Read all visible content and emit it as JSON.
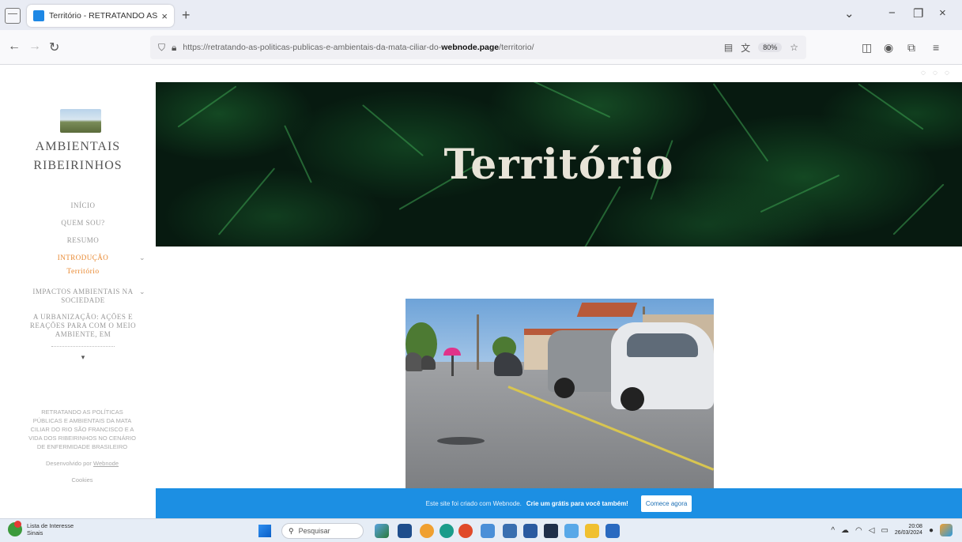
{
  "browser": {
    "tab_title": "Território - RETRATANDO AS P",
    "tab_close": "×",
    "new_tab": "+",
    "url_prefix": "https://retratando-as-politicas-publicas-e-ambientais-da-mata-ciliar-do-",
    "url_domain": "webnode.page",
    "url_suffix": "/territorio/",
    "zoom": "80%",
    "back": "←",
    "forward": "→",
    "reload": "↻",
    "minimize": "−",
    "restore": "❐",
    "close": "×",
    "tabs_dropdown": "⌄"
  },
  "sidebar": {
    "site_name_line1": "AMBIENTAIS",
    "site_name_line2": "RIBEIRINHOS",
    "menu": [
      {
        "label": "INÍCIO"
      },
      {
        "label": "QUEM SOU?"
      },
      {
        "label": "RESUMO"
      },
      {
        "label": "INTRODUÇÃO"
      },
      {
        "label": "Território"
      },
      {
        "label": "IMPACTOS AMBIENTAIS NA SOCIEDADE"
      },
      {
        "label": "A URBANIZAÇÃO: AÇÕES E REAÇÕES PARA COM O MEIO AMBIENTE, EM"
      }
    ],
    "more_arrow": "▾",
    "footer_text": "RETRATANDO AS POLÍTICAS PÚBLICAS E AMBIENTAIS DA MATA CILIAR DO RIO SÃO FRANCISCO E A VIDA DOS RIBEIRINHOS NO CENÁRIO DE ENFERMIDADE BRASILEIRO",
    "powered_by": "Desenvolvido por",
    "powered_link": "Webnode",
    "cookies": "Cookies"
  },
  "hero": {
    "title": "Território"
  },
  "promo": {
    "text": "Este site foi criado com Webnode.",
    "strong": "Crie um grátis para você também!",
    "button": "Comece agora"
  },
  "taskbar": {
    "weather_line1": "Lista de Interesse",
    "weather_line2": "Sinais",
    "search_placeholder": "Pesquisar",
    "time": "20:08",
    "date": "26/03/2024"
  }
}
